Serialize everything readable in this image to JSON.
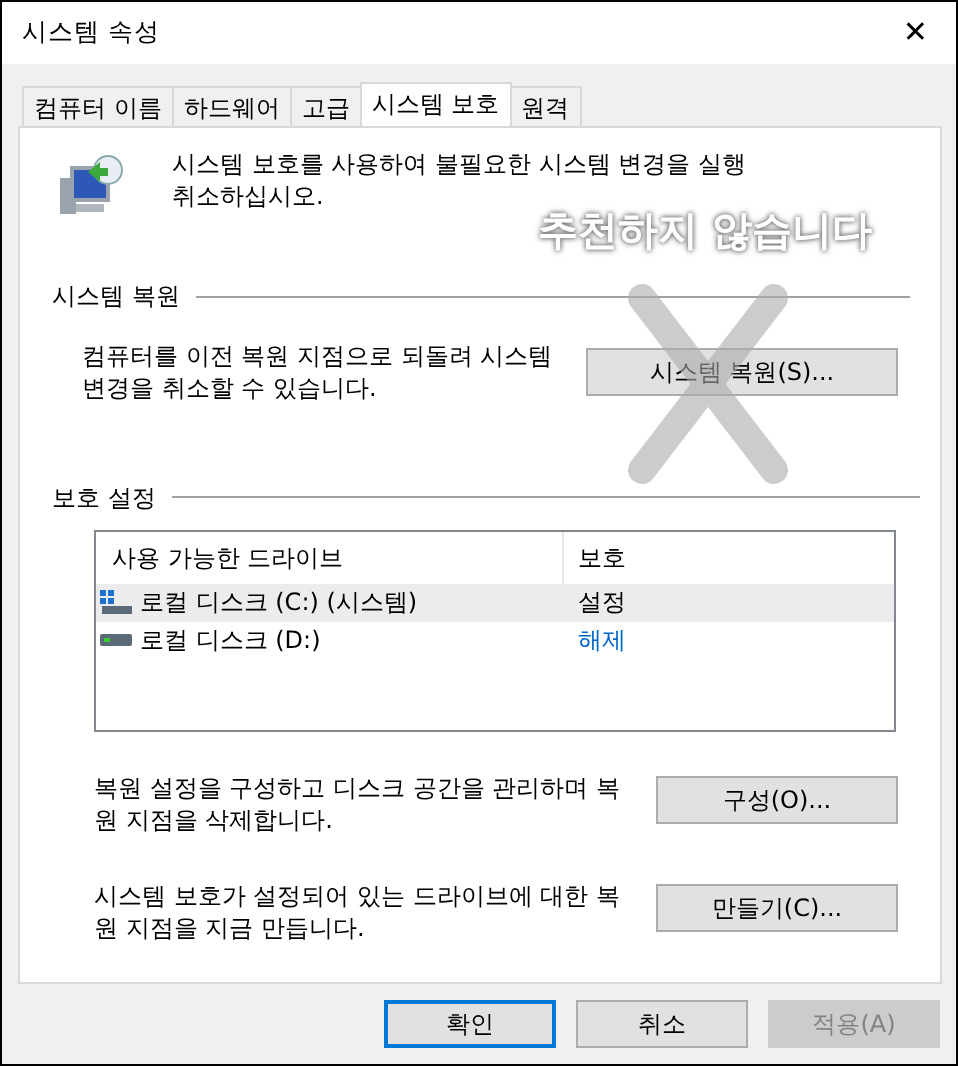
{
  "window": {
    "title": "시스템 속성",
    "close": "✕"
  },
  "tabs": [
    {
      "label": "컴퓨터 이름",
      "selected": false
    },
    {
      "label": "하드웨어",
      "selected": false
    },
    {
      "label": "고급",
      "selected": false
    },
    {
      "label": "시스템 보호",
      "selected": true
    },
    {
      "label": "원격",
      "selected": false
    }
  ],
  "intro": "시스템 보호를 사용하여 불필요한 시스템 변경을 실행 취소하십시오.",
  "restore_section": {
    "title": "시스템 복원",
    "description": "컴퓨터를 이전 복원 지점으로 되돌려 시스템 변경을 취소할 수 있습니다.",
    "button": "시스템 복원(S)..."
  },
  "protection_section": {
    "title": "보호 설정",
    "table": {
      "columns": [
        "사용 가능한 드라이브",
        "보호"
      ],
      "rows": [
        {
          "drive": "로컬 디스크 (C:) (시스템)",
          "protection": "설정",
          "system": true,
          "protected": true,
          "selected": true
        },
        {
          "drive": "로컬 디스크 (D:)",
          "protection": "해제",
          "system": false,
          "protected": false,
          "selected": false
        }
      ]
    },
    "actions": [
      {
        "description": "복원 설정을 구성하고 디스크 공간을 관리하며 복원 지점을 삭제합니다.",
        "button": "구성(O)..."
      },
      {
        "description": "시스템 보호가 설정되어 있는 드라이브에 대한 복원 지점을 지금 만듭니다.",
        "button": "만들기(C)..."
      }
    ]
  },
  "buttons": [
    {
      "label": "확인",
      "default": true,
      "disabled": false
    },
    {
      "label": "취소",
      "default": false,
      "disabled": false
    },
    {
      "label": "적용(A)",
      "default": false,
      "disabled": true
    }
  ],
  "overlay": {
    "text": "추천하지 않습니다"
  }
}
